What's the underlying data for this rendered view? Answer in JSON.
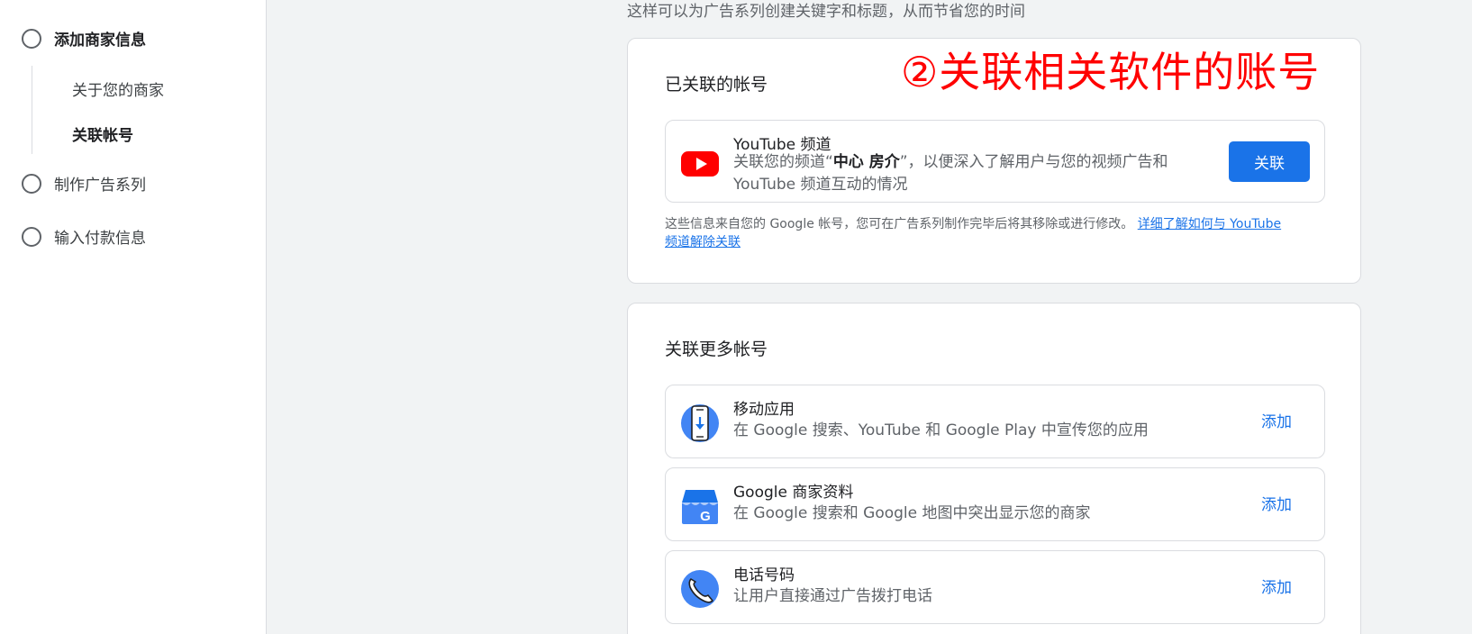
{
  "sidebar": {
    "steps": [
      {
        "label": "添加商家信息"
      },
      {
        "label": "制作广告系列"
      },
      {
        "label": "输入付款信息"
      }
    ],
    "substeps": [
      {
        "label": "关于您的商家"
      },
      {
        "label": "关联帐号"
      }
    ]
  },
  "intro_text": "这样可以为广告系列创建关键字和标题，从而节省您的时间",
  "annotation": "②关联相关软件的账号",
  "linked_card": {
    "title": "已关联的帐号",
    "youtube": {
      "title": "YouTube 频道",
      "desc_before": "关联您的频道“",
      "channel": "中心 房介",
      "desc_after": "”，以便深入了解用户与您的视频广告和 YouTube 频道互动的情况",
      "button": "关联"
    },
    "note": "这些信息来自您的 Google 帐号，您可在广告系列制作完毕后将其移除或进行修改。",
    "note_link": "详细了解如何与 YouTube 频道解除关联"
  },
  "more_card": {
    "title": "关联更多帐号",
    "items": [
      {
        "title": "移动应用",
        "desc": "在 Google 搜索、YouTube 和 Google Play 中宣传您的应用",
        "button": "添加"
      },
      {
        "title": "Google 商家资料",
        "desc": "在 Google 搜索和 Google 地图中突出显示您的商家",
        "button": "添加"
      },
      {
        "title": "电话号码",
        "desc": "让用户直接通过广告拨打电话",
        "button": "添加"
      }
    ]
  },
  "colors": {
    "accent": "#1a73e8",
    "youtube_red": "#ff0000",
    "annotation": "#ff0000"
  }
}
